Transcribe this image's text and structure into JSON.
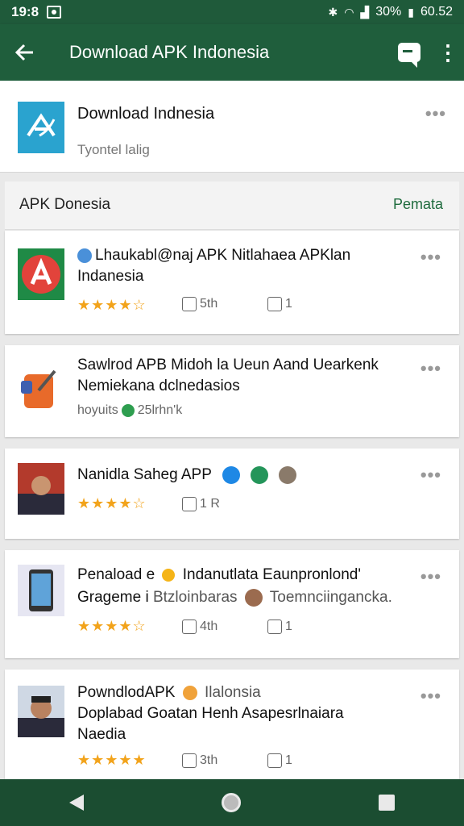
{
  "status": {
    "time": "19:8",
    "battery": "30%",
    "clock": "60.52"
  },
  "appbar": {
    "title": "Download APK Indonesia"
  },
  "header": {
    "title": "Download Indnesia",
    "subtitle": "Tyontel lalig"
  },
  "section": {
    "label": "APK Donesia",
    "action": "Pemata"
  },
  "items": [
    {
      "line1": "Lhaukabl@naj APK Nitlahaea APKlan",
      "line2": "Indanesia",
      "rating": "★★★★☆",
      "count1": "5th",
      "count2": "1"
    },
    {
      "line1": "Sawlrod APB Midoh la Ueun Aand Uearkenk",
      "line2": "Nemiekana dclnedasios",
      "meta_a": "hoyuits",
      "meta_b": "25lrhn'k"
    },
    {
      "line1": "Nanidla Saheg APP",
      "rating": "★★★★☆",
      "count1": "1 R"
    },
    {
      "line1": "Penaload e",
      "line1b": "Indanutlata Eaunpronlond'",
      "line2": "Grageme i",
      "line2b": "Btzloinbaras",
      "line2c": "Toemnciingancka.",
      "rating": "★★★★☆",
      "count1": "4th",
      "count2": "1"
    },
    {
      "line1": "PowndlodAPK",
      "line1b": "Ilalonsia",
      "line2": "Doplabad Goatan Henh Asapesrlnaiara",
      "line3": "Naedia",
      "rating": "★★★★★",
      "count1": "3th",
      "count2": "1"
    }
  ]
}
